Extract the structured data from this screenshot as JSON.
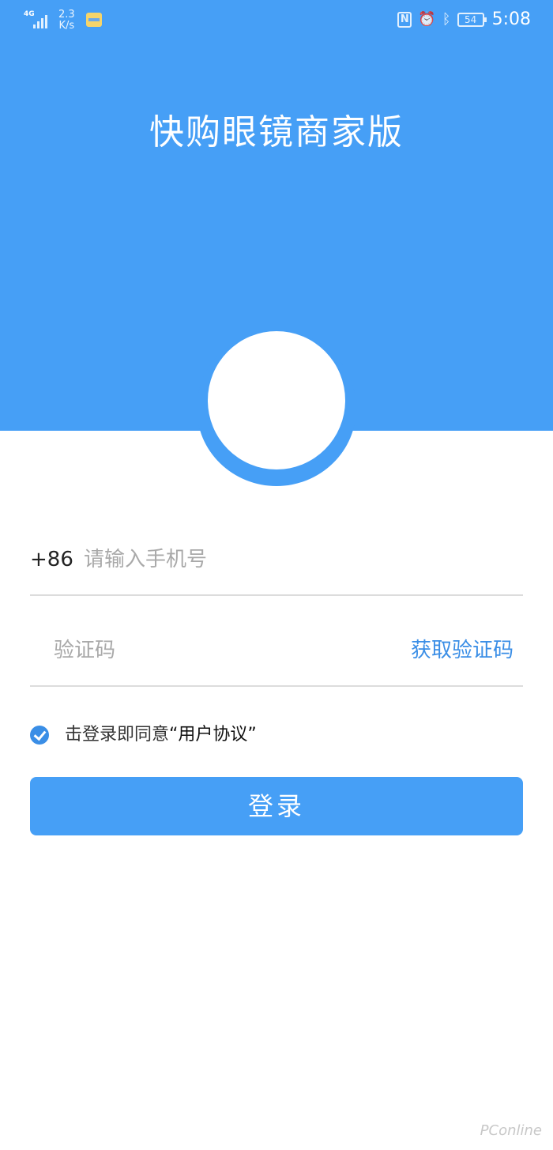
{
  "status_bar": {
    "network": "4G",
    "speed_value": "2.3",
    "speed_unit": "K/s",
    "battery": "54",
    "time": "5:08"
  },
  "app": {
    "title": "快购眼镜商家版"
  },
  "form": {
    "country_code": "+86",
    "phone_placeholder": "请输入手机号",
    "code_placeholder": "验证码",
    "get_code_label": "获取验证码",
    "agreement_checked": true,
    "agreement_text": "击登录即同意",
    "agreement_link": "“用户协议”",
    "login_label": "登录"
  },
  "watermark": "PConline",
  "colors": {
    "primary": "#469ff6",
    "link": "#3a8ee6",
    "divider": "#dcdcdc",
    "placeholder": "#a9a9a9"
  }
}
